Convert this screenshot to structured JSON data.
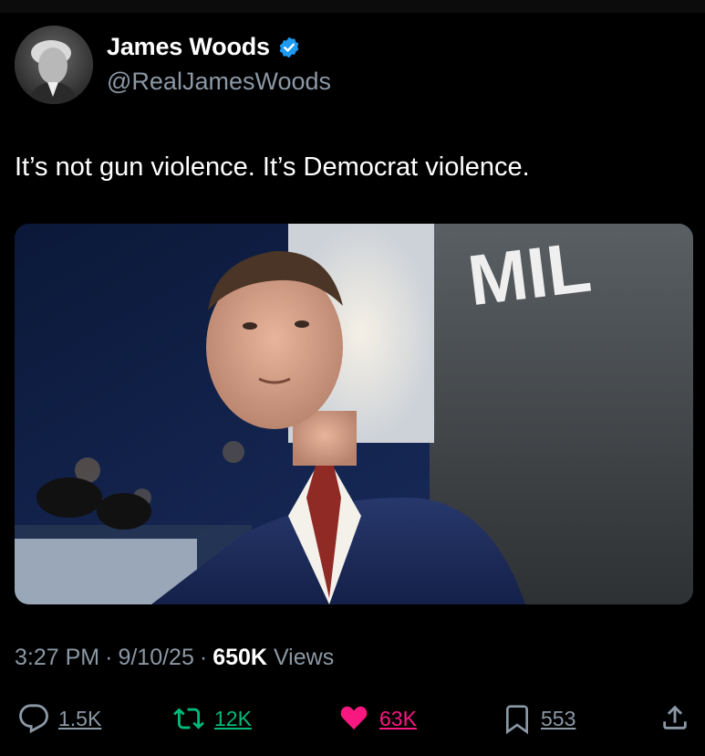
{
  "author": {
    "display_name": "James Woods",
    "handle": "@RealJamesWoods",
    "verified_icon": "verified-badge-icon"
  },
  "tweet": {
    "text": "It’s not gun violence. It’s Democrat violence.",
    "media_sign_text": "MIL"
  },
  "meta": {
    "time": "3:27 PM",
    "separator": "·",
    "date": "9/10/25",
    "views_count": "650K",
    "views_label": "Views"
  },
  "actions": {
    "replies": "1.5K",
    "retweets": "12K",
    "likes": "63K",
    "bookmarks": "553"
  },
  "colors": {
    "background": "#000000",
    "text_primary": "#ffffff",
    "text_secondary": "#8b98a5",
    "verified_blue": "#1d9bf0",
    "retweet_green": "#00ba7c",
    "like_pink": "#f91880"
  }
}
